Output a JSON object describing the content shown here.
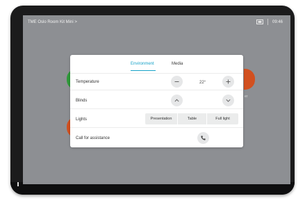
{
  "header": {
    "room_title": "TME Oslo Room Kit Mini",
    "chevron": ">",
    "time": "09:46",
    "status_icon": "screen-share-icon"
  },
  "background": {
    "right_text": "er",
    "bottom_labels": [
      "",
      "",
      ""
    ]
  },
  "panel": {
    "tabs": [
      {
        "label": "Environment",
        "active": true
      },
      {
        "label": "Media",
        "active": false
      }
    ],
    "temperature": {
      "label": "Temperature",
      "value": "22°"
    },
    "blinds": {
      "label": "Blinds"
    },
    "lights": {
      "label": "Lights",
      "options": [
        "Presentation",
        "Table",
        "Full light"
      ]
    },
    "assistance": {
      "label": "Call for assistance"
    }
  },
  "colors": {
    "accent": "#17a2c8",
    "green": "#2f9a3a",
    "orange": "#d2501f"
  }
}
